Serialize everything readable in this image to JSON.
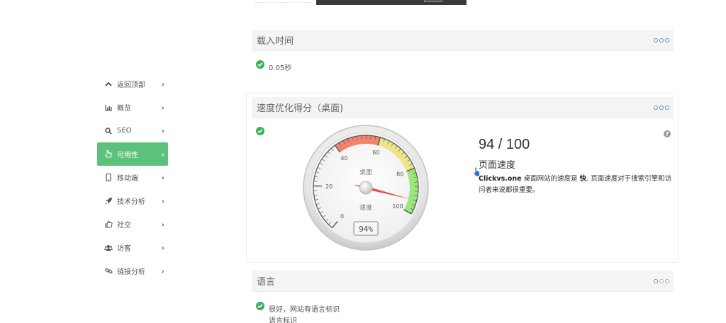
{
  "sidebar": {
    "items": [
      {
        "label": "返回顶部",
        "icon": "chevron-up-icon"
      },
      {
        "label": "概览",
        "icon": "bar-chart-icon"
      },
      {
        "label": "SEO",
        "icon": "search-icon"
      },
      {
        "label": "可用性",
        "icon": "hand-pointer-icon",
        "active": true
      },
      {
        "label": "移动端",
        "icon": "mobile-icon"
      },
      {
        "label": "技术分析",
        "icon": "rocket-icon"
      },
      {
        "label": "社交",
        "icon": "thumbs-up-icon"
      },
      {
        "label": "访客",
        "icon": "users-icon"
      },
      {
        "label": "链接分析",
        "icon": "link-icon"
      }
    ],
    "active_color": "#5cc27b"
  },
  "load_time": {
    "title": "载入时间",
    "value": "0.05秒"
  },
  "speed": {
    "title": "速度优化得分（桌面)",
    "score": "94 / 100",
    "score_label": "页面速度",
    "desc_site": "Clickvs.one",
    "desc_part1": " 桌面网站的速度是 ",
    "desc_speed": "快",
    "desc_part2": ". 页面速度对于搜索引擎和访问者来说都很重要。",
    "gauge": {
      "value": 94,
      "min": 0,
      "max": 100,
      "tick_labels": [
        "0",
        "20",
        "40",
        "60",
        "80",
        "100"
      ],
      "label_top": "桌面",
      "label_bottom": "速度",
      "readout": "94%"
    }
  },
  "language": {
    "title": "语言",
    "status": "很好，网站有语言标识",
    "sub": "语言标识"
  },
  "colors": {
    "success": "#3cb15a",
    "dots": "#5a86c8"
  }
}
